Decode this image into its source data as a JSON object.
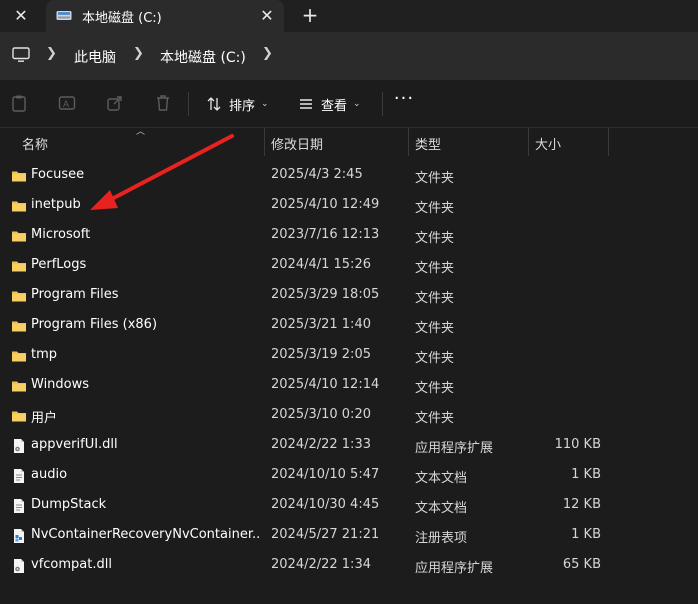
{
  "tab": {
    "title": "本地磁盘 (C:)"
  },
  "breadcrumb": {
    "items": [
      "此电脑",
      "本地磁盘 (C:)"
    ]
  },
  "toolbar": {
    "sort_label": "排序",
    "view_label": "查看",
    "more_label": "···"
  },
  "columns": {
    "name": "名称",
    "date": "修改日期",
    "type": "类型",
    "size": "大小"
  },
  "files": [
    {
      "name": "Focusee",
      "date": "2025/4/3 2:45",
      "type": "文件夹",
      "size": "",
      "icon": "folder-icon"
    },
    {
      "name": "inetpub",
      "date": "2025/4/10 12:49",
      "type": "文件夹",
      "size": "",
      "icon": "folder-icon"
    },
    {
      "name": "Microsoft",
      "date": "2023/7/16 12:13",
      "type": "文件夹",
      "size": "",
      "icon": "folder-icon"
    },
    {
      "name": "PerfLogs",
      "date": "2024/4/1 15:26",
      "type": "文件夹",
      "size": "",
      "icon": "folder-icon"
    },
    {
      "name": "Program Files",
      "date": "2025/3/29 18:05",
      "type": "文件夹",
      "size": "",
      "icon": "folder-icon"
    },
    {
      "name": "Program Files (x86)",
      "date": "2025/3/21 1:40",
      "type": "文件夹",
      "size": "",
      "icon": "folder-icon"
    },
    {
      "name": "tmp",
      "date": "2025/3/19 2:05",
      "type": "文件夹",
      "size": "",
      "icon": "folder-icon"
    },
    {
      "name": "Windows",
      "date": "2025/4/10 12:14",
      "type": "文件夹",
      "size": "",
      "icon": "folder-icon"
    },
    {
      "name": "用户",
      "date": "2025/3/10 0:20",
      "type": "文件夹",
      "size": "",
      "icon": "folder-icon"
    },
    {
      "name": "appverifUI.dll",
      "date": "2024/2/22 1:33",
      "type": "应用程序扩展",
      "size": "110 KB",
      "icon": "dll-file-icon"
    },
    {
      "name": "audio",
      "date": "2024/10/10 5:47",
      "type": "文本文档",
      "size": "1 KB",
      "icon": "text-file-icon"
    },
    {
      "name": "DumpStack",
      "date": "2024/10/30 4:45",
      "type": "文本文档",
      "size": "12 KB",
      "icon": "text-file-icon"
    },
    {
      "name": "NvContainerRecoveryNvContainer...",
      "date": "2024/5/27 21:21",
      "type": "注册表项",
      "size": "1 KB",
      "icon": "registry-file-icon"
    },
    {
      "name": "vfcompat.dll",
      "date": "2024/2/22 1:34",
      "type": "应用程序扩展",
      "size": "65 KB",
      "icon": "dll-file-icon"
    }
  ],
  "colors": {
    "folder": "#f2c14e",
    "annotation_arrow": "#e8231f",
    "background": "#1c1c1c"
  }
}
